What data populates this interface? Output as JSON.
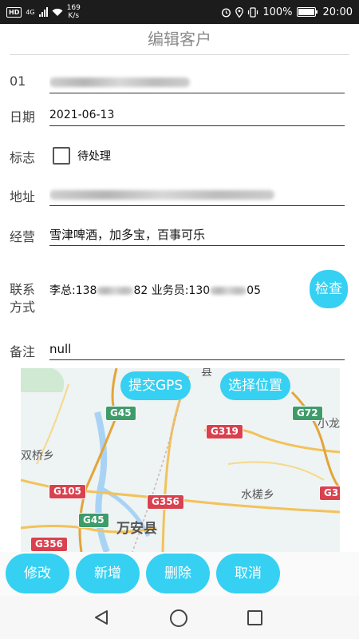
{
  "status_bar": {
    "hd": "HD",
    "network": "4G",
    "speed_value": "169",
    "speed_unit": "K/s",
    "battery": "100%",
    "time": "20:00"
  },
  "header": {
    "title": "编辑客户"
  },
  "form": {
    "id_label": "01",
    "date_label": "日期",
    "date_value": "2021-06-13",
    "flag_label": "标志",
    "flag_checkbox_label": "待处理",
    "address_label": "地址",
    "business_label": "经营",
    "business_value": "雪津啤酒，加多宝，百事可乐",
    "contact_label_1": "联系",
    "contact_label_2": "方式",
    "contact_part1": "李总:138",
    "contact_part2": "82 业务员:130",
    "contact_part3": "05",
    "check_button": "检查",
    "note_label": "备注",
    "note_value": "null"
  },
  "map": {
    "submit_gps": "提交GPS",
    "choose_location": "选择位置",
    "roads": [
      "G45",
      "G72",
      "G319",
      "G105",
      "G356",
      "G45",
      "G356",
      "G3"
    ],
    "places": [
      "双桥乡",
      "水槎乡",
      "万安县",
      "小龙",
      "县"
    ]
  },
  "actions": {
    "modify": "修改",
    "add": "新增",
    "delete": "删除",
    "cancel": "取消"
  }
}
